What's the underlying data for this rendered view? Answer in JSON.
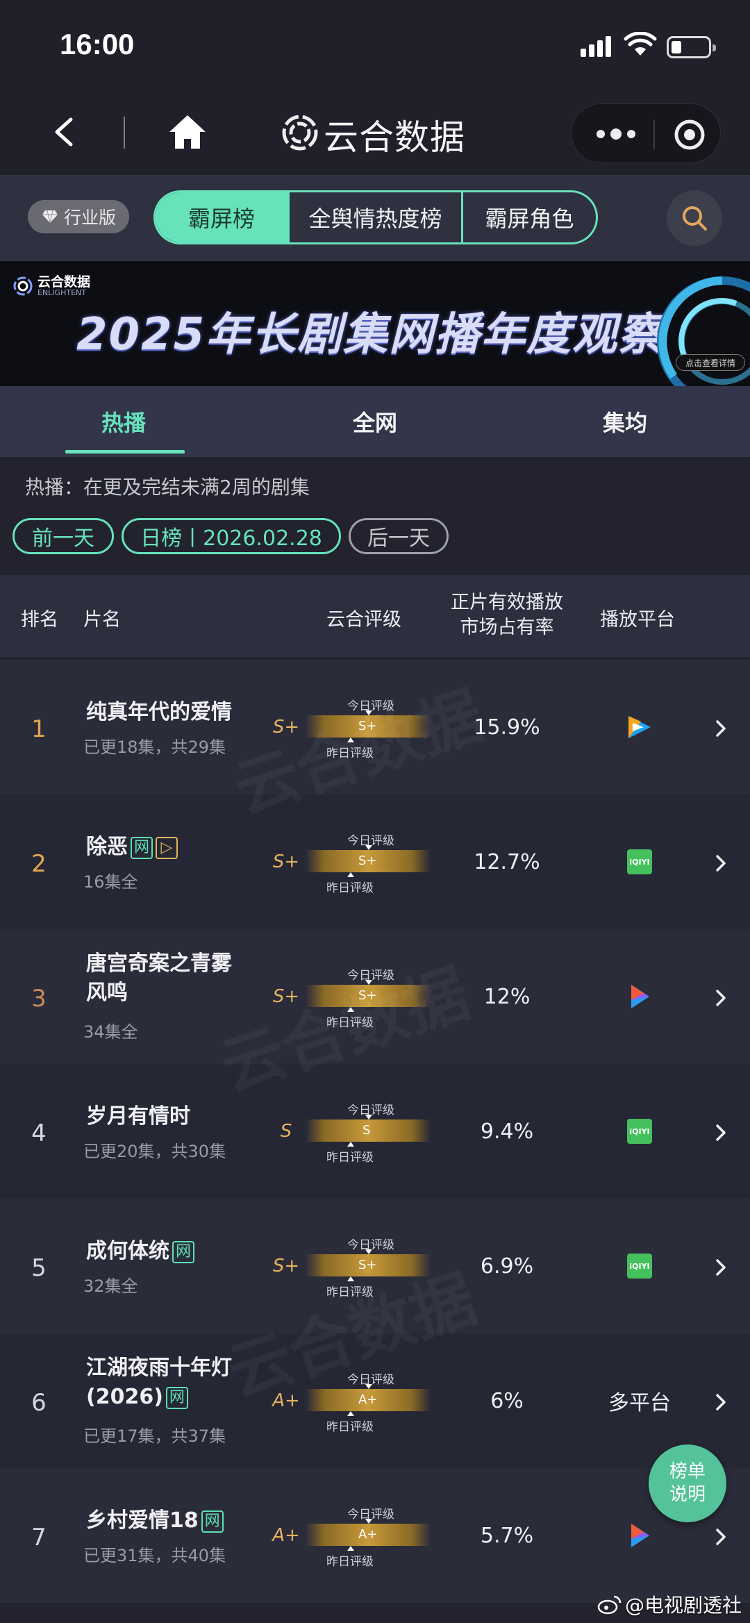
{
  "status": {
    "time": "16:00"
  },
  "nav": {
    "title": "云合数据"
  },
  "category_tabs": {
    "badge": "行业版",
    "tabs": [
      "霸屏榜",
      "全舆情热度榜",
      "霸屏角色"
    ]
  },
  "banner": {
    "logo_cn": "云合数据",
    "logo_en": "ENLIGHTENT",
    "title": "2025年长剧集网播年度观察",
    "cta": "点击查看详情"
  },
  "sub_tabs": [
    "热播",
    "全网",
    "集均"
  ],
  "description": "热播：在更及完结未满2周的剧集",
  "date_nav": {
    "prev": "前一天",
    "current": "日榜丨2026.02.28",
    "next": "后一天"
  },
  "table_header": {
    "rank": "排名",
    "title": "片名",
    "grade": "云合评级",
    "share_line1": "正片有效播放",
    "share_line2": "市场占有率",
    "platform": "播放平台"
  },
  "gauge_labels": {
    "today": "今日评级",
    "yesterday": "昨日评级"
  },
  "rows": [
    {
      "rank": "1",
      "title_lines": [
        "纯真年代的爱情"
      ],
      "tags": [],
      "subtitle": "已更18集，共29集",
      "grade": "S+",
      "bar_grade": "S+",
      "share": "15.9%",
      "platform": "tencent-video-icon",
      "platform_text": ""
    },
    {
      "rank": "2",
      "title_lines": [
        "除恶"
      ],
      "tags": [
        "网",
        "▷"
      ],
      "subtitle": "16集全",
      "grade": "S+",
      "bar_grade": "S+",
      "share": "12.7%",
      "platform": "iqiyi-icon",
      "platform_text": "iQIYI"
    },
    {
      "rank": "3",
      "title_lines": [
        "唐宫奇案之青雾",
        "风鸣"
      ],
      "tags": [],
      "subtitle": "34集全",
      "grade": "S+",
      "bar_grade": "S+",
      "share": "12%",
      "platform": "youku-icon",
      "platform_text": ""
    },
    {
      "rank": "4",
      "title_lines": [
        "岁月有情时"
      ],
      "tags": [],
      "subtitle": "已更20集，共30集",
      "grade": "S",
      "bar_grade": "S",
      "share": "9.4%",
      "platform": "iqiyi-icon",
      "platform_text": "iQIYI"
    },
    {
      "rank": "5",
      "title_lines": [
        "成何体统"
      ],
      "tags": [
        "网"
      ],
      "subtitle": "32集全",
      "grade": "S+",
      "bar_grade": "S+",
      "share": "6.9%",
      "platform": "iqiyi-icon",
      "platform_text": "iQIYI"
    },
    {
      "rank": "6",
      "title_lines": [
        "江湖夜雨十年灯",
        "(2026)"
      ],
      "tags": [
        "网"
      ],
      "subtitle": "已更17集，共37集",
      "grade": "A+",
      "bar_grade": "A+",
      "share": "6%",
      "platform": "multi",
      "platform_text": "多平台"
    },
    {
      "rank": "7",
      "title_lines": [
        "乡村爱情18"
      ],
      "tags": [
        "网"
      ],
      "subtitle": "已更31集，共40集",
      "grade": "A+",
      "bar_grade": "A+",
      "share": "5.7%",
      "platform": "youku-icon",
      "platform_text": ""
    }
  ],
  "float_button": {
    "line1": "榜单",
    "line2": "说明"
  },
  "watermark": {
    "cn": "云合数据",
    "en": "ENLIGHTENT",
    "corner": "@电视剧透社"
  },
  "colors": {
    "accent": "#67e3bb",
    "grade_gold": "#e6b260",
    "rank_top": "#e0a552",
    "rank_third": "#c98a5c",
    "rank_normal": "#d6d7de",
    "background": "#22232e"
  }
}
